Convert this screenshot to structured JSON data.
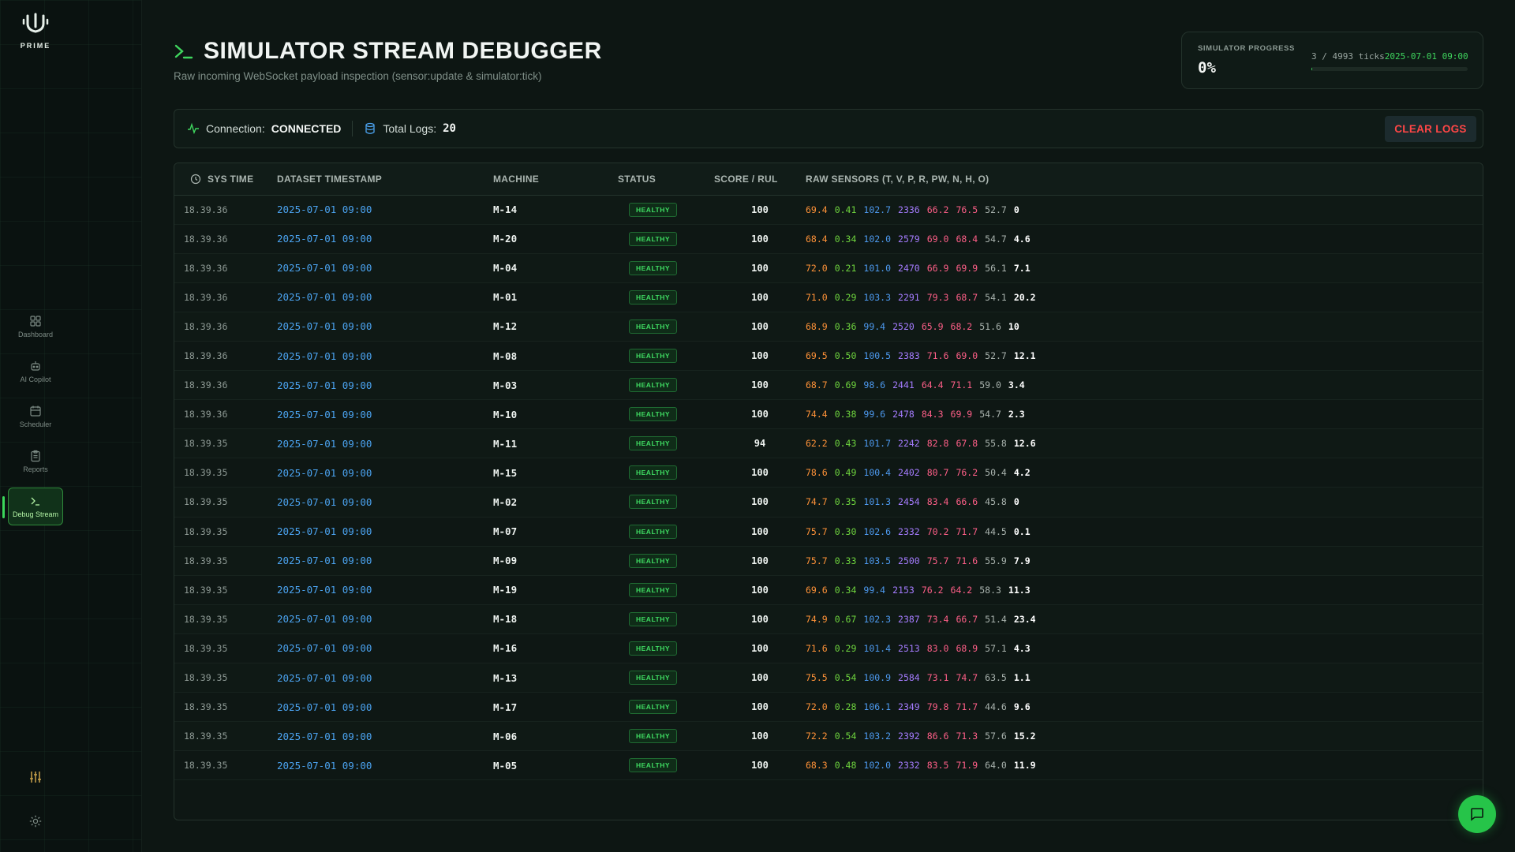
{
  "app": {
    "name": "PRIME"
  },
  "sidebar": {
    "items": [
      {
        "label": "Dashboard",
        "icon": "grid-icon"
      },
      {
        "label": "AI Copilot",
        "icon": "robot-icon"
      },
      {
        "label": "Scheduler",
        "icon": "calendar-icon"
      },
      {
        "label": "Reports",
        "icon": "clipboard-icon"
      },
      {
        "label": "Debug Stream",
        "icon": "terminal-icon",
        "active": true
      }
    ],
    "bottom_icons": [
      "sliders-icon",
      "gear-icon"
    ]
  },
  "header": {
    "title": "SIMULATOR STREAM DEBUGGER",
    "subtitle": "Raw incoming WebSocket payload inspection (sensor:update & simulator:tick)"
  },
  "progress": {
    "label": "SIMULATOR PROGRESS",
    "percent_text": "0%",
    "ticks_text": "3 / 4993 ticks",
    "current_date": "2025-07-01 09:00",
    "fraction": 0.0006
  },
  "connection": {
    "label": "Connection:",
    "status": "CONNECTED",
    "logs_label": "Total Logs:",
    "logs_count": "20",
    "clear_label": "CLEAR LOGS"
  },
  "colors": {
    "accent_green": "#3fd65e",
    "danger_red": "#ff4646",
    "link_blue": "#4ba3f0"
  },
  "table": {
    "headers": {
      "sys_time": "SYS TIME",
      "dataset_timestamp": "DATASET TIMESTAMP",
      "machine": "MACHINE",
      "status": "STATUS",
      "score": "SCORE / RUL",
      "sensors": "RAW SENSORS (T, V, P, R, PW, N, H, O)"
    },
    "rows": [
      {
        "time": "18.39.36",
        "ts": "2025-07-01 09:00",
        "machine": "M-14",
        "status": "HEALTHY",
        "score": "100",
        "sensors": [
          "69.4",
          "0.41",
          "102.7",
          "2336",
          "66.2",
          "76.5",
          "52.7",
          "0"
        ]
      },
      {
        "time": "18.39.36",
        "ts": "2025-07-01 09:00",
        "machine": "M-20",
        "status": "HEALTHY",
        "score": "100",
        "sensors": [
          "68.4",
          "0.34",
          "102.0",
          "2579",
          "69.0",
          "68.4",
          "54.7",
          "4.6"
        ]
      },
      {
        "time": "18.39.36",
        "ts": "2025-07-01 09:00",
        "machine": "M-04",
        "status": "HEALTHY",
        "score": "100",
        "sensors": [
          "72.0",
          "0.21",
          "101.0",
          "2470",
          "66.9",
          "69.9",
          "56.1",
          "7.1"
        ]
      },
      {
        "time": "18.39.36",
        "ts": "2025-07-01 09:00",
        "machine": "M-01",
        "status": "HEALTHY",
        "score": "100",
        "sensors": [
          "71.0",
          "0.29",
          "103.3",
          "2291",
          "79.3",
          "68.7",
          "54.1",
          "20.2"
        ]
      },
      {
        "time": "18.39.36",
        "ts": "2025-07-01 09:00",
        "machine": "M-12",
        "status": "HEALTHY",
        "score": "100",
        "sensors": [
          "68.9",
          "0.36",
          "99.4",
          "2520",
          "65.9",
          "68.2",
          "51.6",
          "10"
        ]
      },
      {
        "time": "18.39.36",
        "ts": "2025-07-01 09:00",
        "machine": "M-08",
        "status": "HEALTHY",
        "score": "100",
        "sensors": [
          "69.5",
          "0.50",
          "100.5",
          "2383",
          "71.6",
          "69.0",
          "52.7",
          "12.1"
        ]
      },
      {
        "time": "18.39.36",
        "ts": "2025-07-01 09:00",
        "machine": "M-03",
        "status": "HEALTHY",
        "score": "100",
        "sensors": [
          "68.7",
          "0.69",
          "98.6",
          "2441",
          "64.4",
          "71.1",
          "59.0",
          "3.4"
        ]
      },
      {
        "time": "18.39.36",
        "ts": "2025-07-01 09:00",
        "machine": "M-10",
        "status": "HEALTHY",
        "score": "100",
        "sensors": [
          "74.4",
          "0.38",
          "99.6",
          "2478",
          "84.3",
          "69.9",
          "54.7",
          "2.3"
        ]
      },
      {
        "time": "18.39.35",
        "ts": "2025-07-01 09:00",
        "machine": "M-11",
        "status": "HEALTHY",
        "score": "94",
        "sensors": [
          "62.2",
          "0.43",
          "101.7",
          "2242",
          "82.8",
          "67.8",
          "55.8",
          "12.6"
        ]
      },
      {
        "time": "18.39.35",
        "ts": "2025-07-01 09:00",
        "machine": "M-15",
        "status": "HEALTHY",
        "score": "100",
        "sensors": [
          "78.6",
          "0.49",
          "100.4",
          "2402",
          "80.7",
          "76.2",
          "50.4",
          "4.2"
        ]
      },
      {
        "time": "18.39.35",
        "ts": "2025-07-01 09:00",
        "machine": "M-02",
        "status": "HEALTHY",
        "score": "100",
        "sensors": [
          "74.7",
          "0.35",
          "101.3",
          "2454",
          "83.4",
          "66.6",
          "45.8",
          "0"
        ]
      },
      {
        "time": "18.39.35",
        "ts": "2025-07-01 09:00",
        "machine": "M-07",
        "status": "HEALTHY",
        "score": "100",
        "sensors": [
          "75.7",
          "0.30",
          "102.6",
          "2332",
          "70.2",
          "71.7",
          "44.5",
          "0.1"
        ]
      },
      {
        "time": "18.39.35",
        "ts": "2025-07-01 09:00",
        "machine": "M-09",
        "status": "HEALTHY",
        "score": "100",
        "sensors": [
          "75.7",
          "0.33",
          "103.5",
          "2500",
          "75.7",
          "71.6",
          "55.9",
          "7.9"
        ]
      },
      {
        "time": "18.39.35",
        "ts": "2025-07-01 09:00",
        "machine": "M-19",
        "status": "HEALTHY",
        "score": "100",
        "sensors": [
          "69.6",
          "0.34",
          "99.4",
          "2153",
          "76.2",
          "64.2",
          "58.3",
          "11.3"
        ]
      },
      {
        "time": "18.39.35",
        "ts": "2025-07-01 09:00",
        "machine": "M-18",
        "status": "HEALTHY",
        "score": "100",
        "sensors": [
          "74.9",
          "0.67",
          "102.3",
          "2387",
          "73.4",
          "66.7",
          "51.4",
          "23.4"
        ]
      },
      {
        "time": "18.39.35",
        "ts": "2025-07-01 09:00",
        "machine": "M-16",
        "status": "HEALTHY",
        "score": "100",
        "sensors": [
          "71.6",
          "0.29",
          "101.4",
          "2513",
          "83.0",
          "68.9",
          "57.1",
          "4.3"
        ]
      },
      {
        "time": "18.39.35",
        "ts": "2025-07-01 09:00",
        "machine": "M-13",
        "status": "HEALTHY",
        "score": "100",
        "sensors": [
          "75.5",
          "0.54",
          "100.9",
          "2584",
          "73.1",
          "74.7",
          "63.5",
          "1.1"
        ]
      },
      {
        "time": "18.39.35",
        "ts": "2025-07-01 09:00",
        "machine": "M-17",
        "status": "HEALTHY",
        "score": "100",
        "sensors": [
          "72.0",
          "0.28",
          "106.1",
          "2349",
          "79.8",
          "71.7",
          "44.6",
          "9.6"
        ]
      },
      {
        "time": "18.39.35",
        "ts": "2025-07-01 09:00",
        "machine": "M-06",
        "status": "HEALTHY",
        "score": "100",
        "sensors": [
          "72.2",
          "0.54",
          "103.2",
          "2392",
          "86.6",
          "71.3",
          "57.6",
          "15.2"
        ]
      },
      {
        "time": "18.39.35",
        "ts": "2025-07-01 09:00",
        "machine": "M-05",
        "status": "HEALTHY",
        "score": "100",
        "sensors": [
          "68.3",
          "0.48",
          "102.0",
          "2332",
          "83.5",
          "71.9",
          "64.0",
          "11.9"
        ]
      }
    ]
  }
}
